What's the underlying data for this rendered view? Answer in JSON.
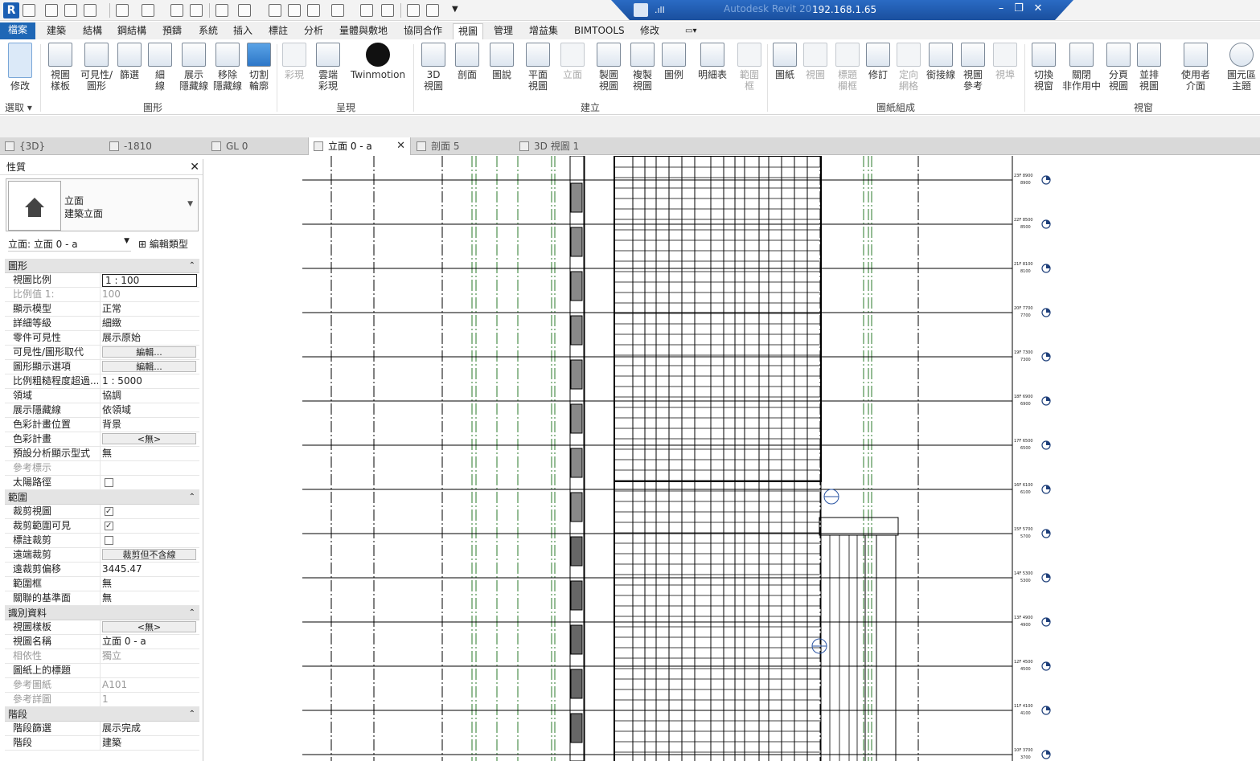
{
  "app": {
    "logo_letter": "R",
    "title": "Autodesk Revit 20",
    "remote_ip": "192.168.1.65",
    "signal": ".ıll"
  },
  "ribbon_tabs": [
    "檔案",
    "建築",
    "結構",
    "鋼結構",
    "預鑄",
    "系統",
    "插入",
    "標註",
    "分析",
    "量體與敷地",
    "協同合作",
    "視圖",
    "管理",
    "增益集",
    "BIMTOOLS",
    "修改"
  ],
  "ribbon": {
    "modify": {
      "label": "修改",
      "panel": "選取"
    },
    "graphics": {
      "panel": "圖形",
      "buttons": [
        "視圖\n樣板",
        "可見性/\n圖形",
        "篩選",
        "細\n線",
        "展示\n隱藏線",
        "移除\n隱藏線",
        "切割\n輪廓"
      ]
    },
    "presentation": {
      "panel": "呈現",
      "buttons": [
        "彩現",
        "雲端\n彩現",
        "Twinmotion"
      ]
    },
    "create": {
      "panel": "建立",
      "buttons": [
        "3D\n視圖",
        "剖面",
        "圖說",
        "平面\n視圖",
        "立面",
        "製圖\n視圖",
        "複製\n視圖",
        "圖例",
        "明細表",
        "範圍\n框"
      ]
    },
    "sheet": {
      "panel": "圖紙組成",
      "buttons": [
        "圖紙",
        "視圖",
        "標題\n欄框",
        "修訂",
        "定向\n網格",
        "銜接線",
        "視圖\n參考",
        "視埠"
      ]
    },
    "windows": {
      "panel": "視窗",
      "buttons": [
        "切換\n視窗",
        "關閉\n非作用中",
        "分頁\n視圖",
        "並排\n視圖",
        "使用者\n介面",
        "圖元區\n主題"
      ]
    }
  },
  "doc_tabs": [
    {
      "label": "{3D}",
      "active": false
    },
    {
      "label": "-1810",
      "active": false
    },
    {
      "label": "GL 0",
      "active": false
    },
    {
      "label": "立面 0 - a",
      "active": true
    },
    {
      "label": "剖面 5",
      "active": false
    },
    {
      "label": "3D 視圖 1",
      "active": false
    }
  ],
  "properties": {
    "title": "性質",
    "type_name": "立面",
    "type_sub": "建築立面",
    "instance": "立面: 立面 0 - a",
    "edit_type": "編輯類型",
    "sections": [
      {
        "name": "圖形",
        "rows": [
          {
            "k": "視圖比例",
            "v": "1 : 100",
            "style": "boxed"
          },
          {
            "k": "比例值 1:",
            "v": "100",
            "dim": true
          },
          {
            "k": "顯示模型",
            "v": "正常"
          },
          {
            "k": "詳細等級",
            "v": "細緻"
          },
          {
            "k": "零件可見性",
            "v": "展示原始"
          },
          {
            "k": "可見性/圖形取代",
            "v": "編輯...",
            "style": "btn"
          },
          {
            "k": "圖形顯示選項",
            "v": "編輯...",
            "style": "btn"
          },
          {
            "k": "比例粗糙程度超過...",
            "v": "1 : 5000"
          },
          {
            "k": "領域",
            "v": "協調"
          },
          {
            "k": "展示隱藏線",
            "v": "依領域"
          },
          {
            "k": "色彩計畫位置",
            "v": "背景"
          },
          {
            "k": "色彩計畫",
            "v": "<無>",
            "style": "btn"
          },
          {
            "k": "預設分析顯示型式",
            "v": "無"
          },
          {
            "k": "參考標示",
            "v": "",
            "dim": true
          },
          {
            "k": "太陽路徑",
            "v": "",
            "check": false
          }
        ]
      },
      {
        "name": "範圍",
        "rows": [
          {
            "k": "裁剪視圖",
            "v": "",
            "check": true
          },
          {
            "k": "裁剪範圍可見",
            "v": "",
            "check": true
          },
          {
            "k": "標註裁剪",
            "v": "",
            "check": false
          },
          {
            "k": "遠端裁剪",
            "v": "裁剪但不含線",
            "style": "btn"
          },
          {
            "k": "遠裁剪偏移",
            "v": "3445.47"
          },
          {
            "k": "範圍框",
            "v": "無"
          },
          {
            "k": "關聯的基準面",
            "v": "無"
          }
        ]
      },
      {
        "name": "識別資料",
        "rows": [
          {
            "k": "視圖樣板",
            "v": "<無>",
            "style": "btn"
          },
          {
            "k": "視圖名稱",
            "v": "立面 0 - a"
          },
          {
            "k": "相依性",
            "v": "獨立",
            "dim": true
          },
          {
            "k": "圖紙上的標題",
            "v": ""
          },
          {
            "k": "參考圖紙",
            "v": "A101",
            "dim": true
          },
          {
            "k": "參考詳圖",
            "v": "1",
            "dim": true
          }
        ]
      },
      {
        "name": "階段",
        "rows": [
          {
            "k": "階段篩選",
            "v": "展示完成"
          },
          {
            "k": "階段",
            "v": "建築"
          }
        ]
      }
    ]
  },
  "levels": [
    {
      "name": "23F 8900",
      "elev": "8900"
    },
    {
      "name": "22F 8500",
      "elev": "8500"
    },
    {
      "name": "21F 8100",
      "elev": "8100"
    },
    {
      "name": "20F 7700",
      "elev": "7700"
    },
    {
      "name": "19F 7300",
      "elev": "7300"
    },
    {
      "name": "18F 6900",
      "elev": "6900"
    },
    {
      "name": "17F 6500",
      "elev": "6500"
    },
    {
      "name": "16F 6100",
      "elev": "6100"
    },
    {
      "name": "15F 5700",
      "elev": "5700"
    },
    {
      "name": "14F 5300",
      "elev": "5300"
    },
    {
      "name": "13F 4900",
      "elev": "4900"
    },
    {
      "name": "12F 4500",
      "elev": "4500"
    },
    {
      "name": "11F 4100",
      "elev": "4100"
    },
    {
      "name": "10F 3700",
      "elev": "3700"
    }
  ],
  "colors": {
    "accent": "#1e67b6",
    "grid_dash_green": "#2a7a2a",
    "line": "#000000"
  }
}
